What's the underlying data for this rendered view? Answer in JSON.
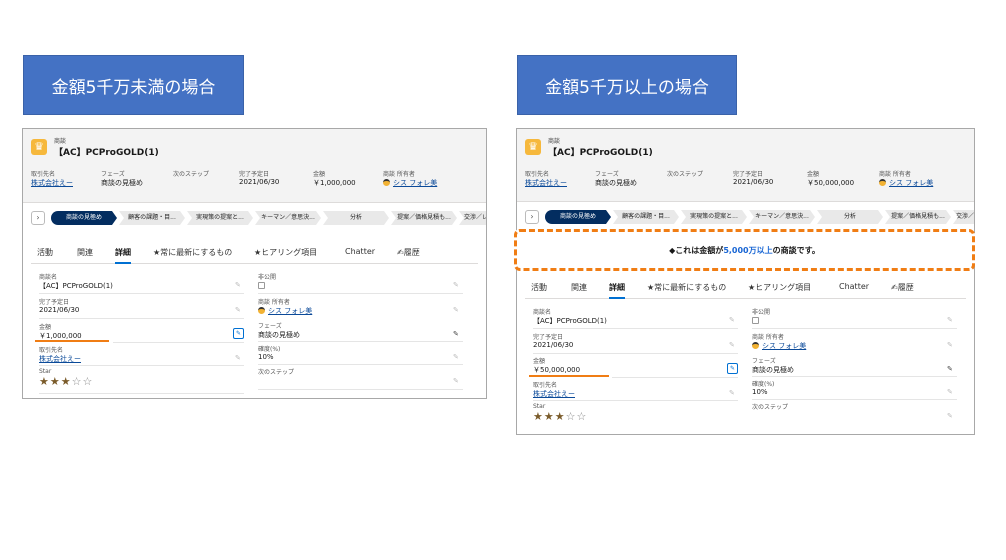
{
  "captions": {
    "left": "金額5千万未満の場合",
    "right": "金額5千万以上の場合"
  },
  "record": {
    "type_label": "商談",
    "title": "【AC】PCProGOLD(1)",
    "header_fields": [
      {
        "label": "取引先名",
        "value": "株式会社えー"
      },
      {
        "label": "フェーズ",
        "value": "商談の見極め"
      },
      {
        "label": "次のステップ",
        "value": ""
      },
      {
        "label": "完了予定日",
        "value": "2021/06/30"
      },
      {
        "label": "金額"
      },
      {
        "label": "商談 所有者",
        "value": "シス フォレ美"
      }
    ],
    "stages": [
      "商談の見極め",
      "顧客の課題・目...",
      "実現策の提案と...",
      "キーマン／意思決...",
      "分析",
      "提案／価格見積も...",
      "交渉／レビ"
    ],
    "stage_nav": "›",
    "tabs": [
      "活動",
      "関連",
      "詳細",
      "★常に最新にするもの",
      "★ヒアリング項目",
      "Chatter",
      "✍履歴"
    ],
    "detail": {
      "name_label": "商談名",
      "name_value": "【AC】PCProGOLD(1)",
      "private_label": "非公開",
      "close_label": "完了予定日",
      "close_value": "2021/06/30",
      "owner_label": "商談 所有者",
      "owner_value": "シス フォレ美",
      "amount_label": "金額",
      "phase_label": "フェーズ",
      "phase_value": "商談の見極め",
      "account_label": "取引先名",
      "account_value": "株式会社えー",
      "prob_label": "確度(%)",
      "prob_value": "10%",
      "star_label": "Star",
      "next_label": "次のステップ"
    },
    "star_rating": {
      "filled": 3,
      "total": 5
    }
  },
  "left": {
    "amount": "￥1,000,000"
  },
  "right": {
    "amount": "￥50,000,000",
    "alert": {
      "prefix": "◆これは金額が",
      "highlight": "5,000万以上",
      "suffix": "の商談です。"
    }
  },
  "icons": [
    "crown-icon",
    "pencil-icon",
    "edit-icon",
    "avatar-icon",
    "star-icon"
  ],
  "colors": {
    "caption": "#4472c4",
    "highlight": "#f07d14",
    "stage_active": "#032d60",
    "link": "#0b4a99"
  }
}
